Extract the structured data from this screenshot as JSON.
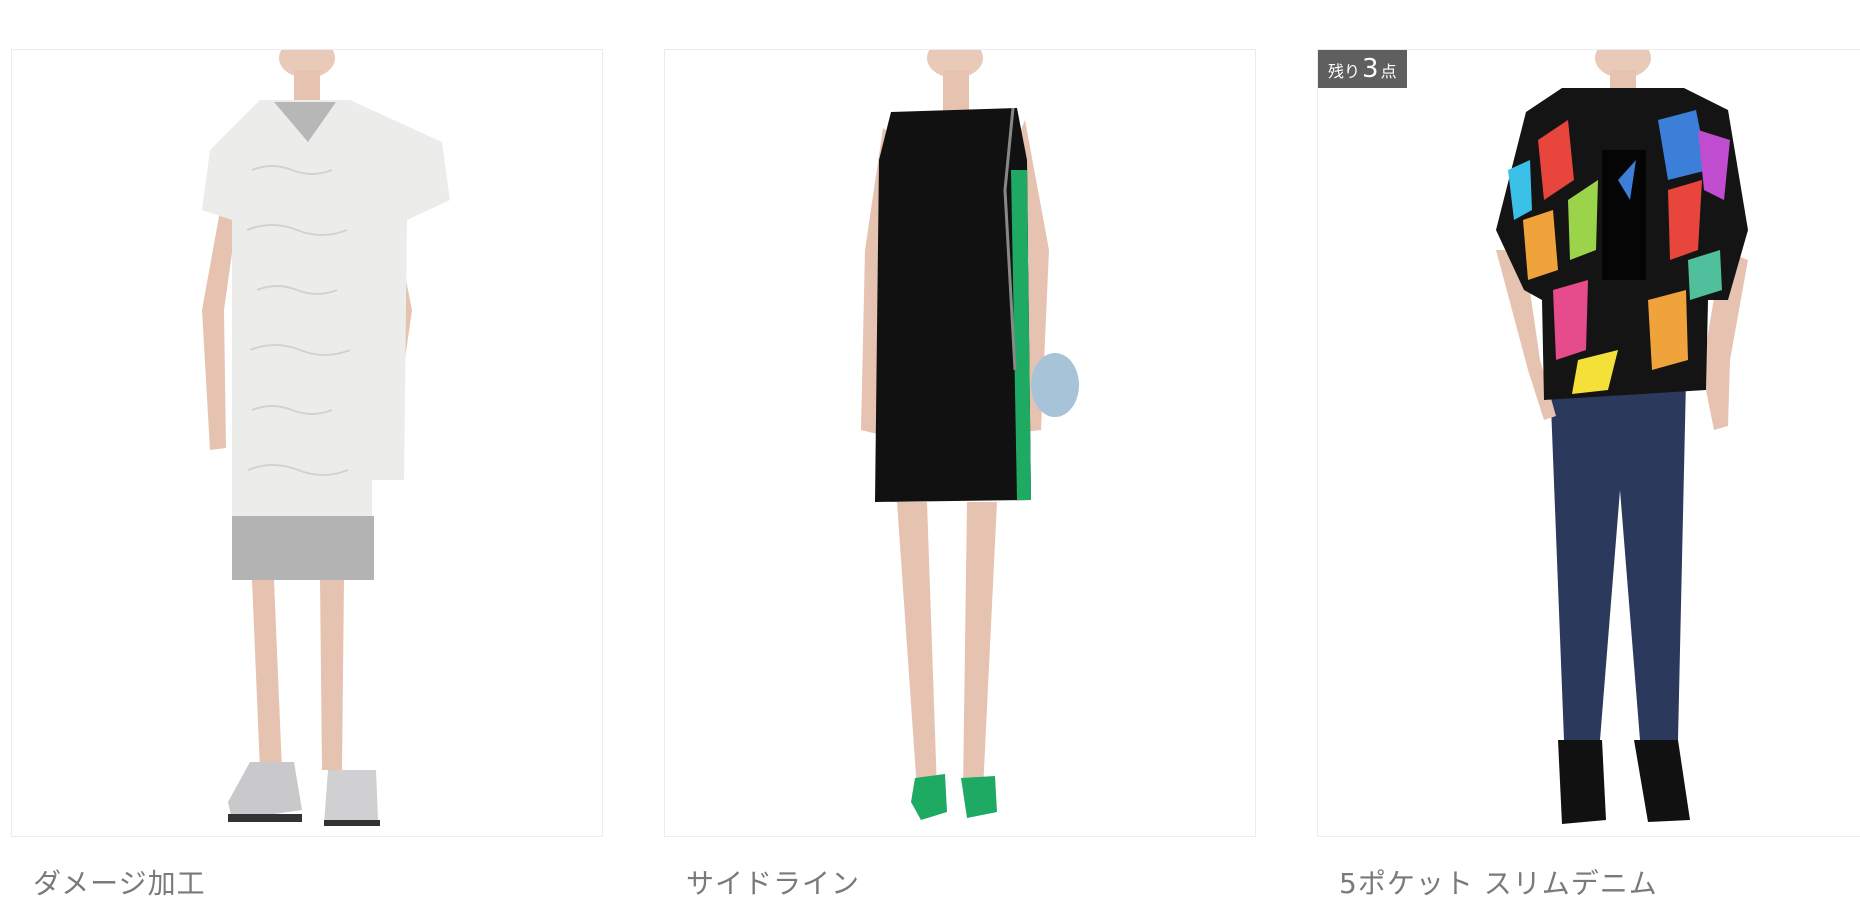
{
  "products": [
    {
      "name": "ダメージ加工"
    },
    {
      "name": "サイドライン"
    },
    {
      "name": "5ポケット スリムデニム"
    }
  ],
  "badge": {
    "prefix": "残り",
    "count": "3",
    "suffix": "点"
  },
  "colors": {
    "badge_bg": "#5f5f5f",
    "text": "#7a7a7a",
    "accent_green": "#1faa63"
  }
}
